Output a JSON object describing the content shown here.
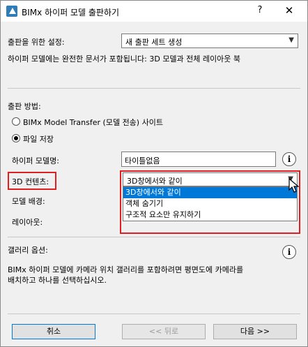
{
  "window": {
    "title": "BIMx 하이퍼 모델 출판하기",
    "help_label": "?",
    "close_label": "✕"
  },
  "publish_settings": {
    "label": "출판을 위한 설정:",
    "value": "새 출판 세트 생성"
  },
  "description": "하이퍼 모델에는 완전한 문서가 포함됩니다: 3D 모델과 전체 레이아웃 북",
  "method": {
    "label": "출판 방법:",
    "options": [
      "BIMx Model Transfer (모델 전송) 사이트",
      "파일 저장"
    ],
    "selected_index": 1
  },
  "model_name": {
    "label": "하이퍼 모델명:",
    "value": "타이틀없음",
    "info": "i"
  },
  "content_3d": {
    "label": "3D 컨텐츠:",
    "value": "3D창에서와 같이",
    "options": [
      "3D창에서와 같이",
      "객체 숨기기",
      "구조적 요소만 유지하기"
    ],
    "selected_index": 0
  },
  "model_background": {
    "label": "모델 배경:"
  },
  "layout": {
    "label": "레이아웃:"
  },
  "gallery": {
    "label": "갤러리 옵션:",
    "info": "i",
    "text_line1": "BIMx 하이퍼 모델에 카메라 위치 갤러리를 포함하려면 평면도에 카메라를",
    "text_line2": "배치하고 하나를 선택하십시오."
  },
  "buttons": {
    "cancel": "취소",
    "back": "<< 뒤로",
    "next": "다음 >>"
  },
  "colors": {
    "highlight": "#0078d7",
    "annotation_red": "#e02020"
  }
}
